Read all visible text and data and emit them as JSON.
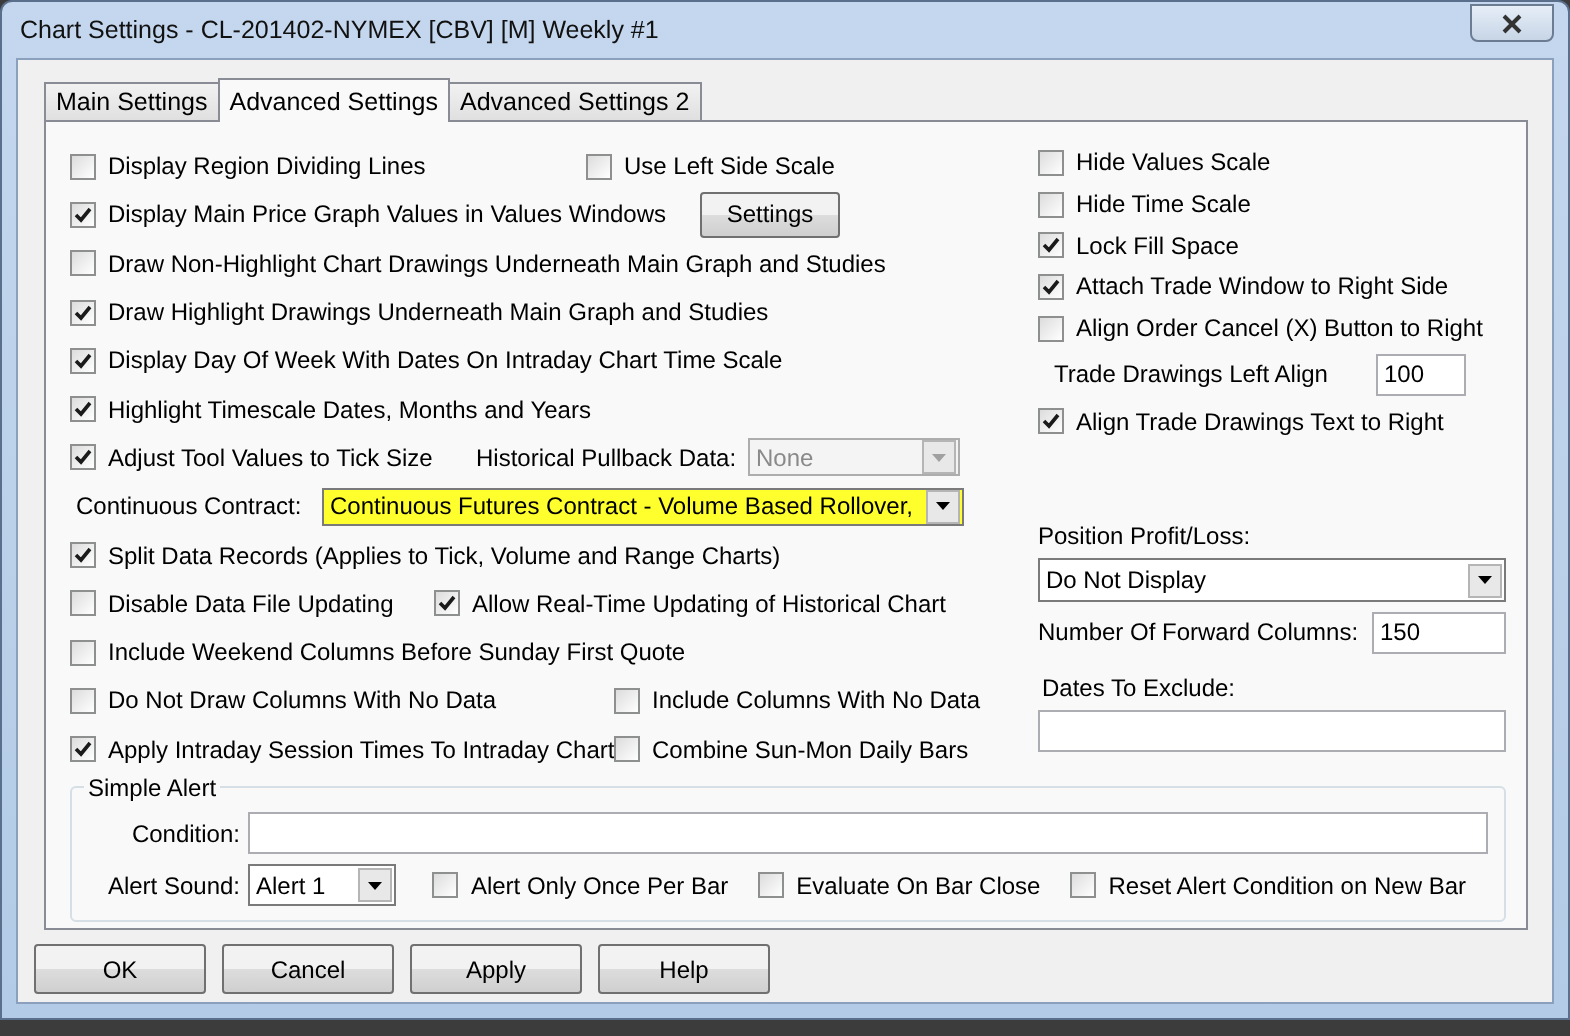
{
  "window": {
    "title": "Chart Settings - CL-201402-NYMEX [CBV] [M]  Weekly  #1"
  },
  "tabs": [
    {
      "label": "Main Settings",
      "selected": false
    },
    {
      "label": "Advanced Settings",
      "selected": true
    },
    {
      "label": "Advanced Settings 2",
      "selected": false
    }
  ],
  "left_rows": [
    {
      "items": [
        {
          "kind": "checkbox",
          "label": "Display Region Dividing Lines",
          "checked": false
        },
        {
          "kind": "checkbox",
          "label": "Use Left Side Scale",
          "checked": false
        }
      ]
    },
    {
      "items": [
        {
          "kind": "checkbox",
          "label": "Display Main Price Graph Values in Values Windows",
          "checked": true
        },
        {
          "kind": "button",
          "label": "Settings"
        }
      ]
    },
    {
      "items": [
        {
          "kind": "checkbox",
          "label": "Draw Non-Highlight Chart Drawings Underneath Main Graph and Studies",
          "checked": false
        }
      ]
    },
    {
      "items": [
        {
          "kind": "checkbox",
          "label": "Draw Highlight Drawings Underneath Main Graph and Studies",
          "checked": true
        }
      ]
    },
    {
      "items": [
        {
          "kind": "checkbox",
          "label": "Display Day Of Week With Dates On Intraday Chart Time Scale",
          "checked": true
        }
      ]
    },
    {
      "items": [
        {
          "kind": "checkbox",
          "label": "Highlight Timescale Dates, Months and Years",
          "checked": true
        }
      ]
    },
    {
      "items": [
        {
          "kind": "checkbox",
          "label": "Adjust Tool Values to Tick Size",
          "checked": true
        },
        {
          "kind": "label",
          "label": "Historical Pullback Data:"
        },
        {
          "kind": "select",
          "value": "None",
          "disabled": true,
          "highlighted": false
        }
      ]
    },
    {
      "items": [
        {
          "kind": "label",
          "label": "Continuous Contract:"
        },
        {
          "kind": "select",
          "value": "Continuous Futures Contract - Volume Based Rollover,",
          "disabled": false,
          "highlighted": true
        }
      ]
    },
    {
      "items": [
        {
          "kind": "checkbox",
          "label": "Split Data Records (Applies to Tick, Volume and Range Charts)",
          "checked": true
        }
      ]
    },
    {
      "items": [
        {
          "kind": "checkbox",
          "label": "Disable Data File Updating",
          "checked": false
        },
        {
          "kind": "checkbox",
          "label": "Allow Real-Time Updating of Historical Chart",
          "checked": true
        }
      ]
    },
    {
      "items": [
        {
          "kind": "checkbox",
          "label": "Include Weekend Columns Before Sunday First Quote",
          "checked": false
        }
      ]
    },
    {
      "items": [
        {
          "kind": "checkbox",
          "label": "Do Not Draw Columns With No Data",
          "checked": false
        },
        {
          "kind": "checkbox",
          "label": "Include Columns With No Data",
          "checked": false
        }
      ]
    },
    {
      "items": [
        {
          "kind": "checkbox",
          "label": "Apply Intraday Session Times To Intraday Chart",
          "checked": true
        },
        {
          "kind": "checkbox",
          "label": "Combine Sun-Mon Daily Bars",
          "checked": false
        }
      ]
    }
  ],
  "right_items": [
    {
      "kind": "checkbox",
      "label": "Hide Values Scale",
      "checked": false
    },
    {
      "kind": "checkbox",
      "label": "Hide Time Scale",
      "checked": false
    },
    {
      "kind": "checkbox",
      "label": "Lock Fill Space",
      "checked": true
    },
    {
      "kind": "checkbox",
      "label": "Attach Trade Window to Right Side",
      "checked": true
    },
    {
      "kind": "checkbox",
      "label": "Align Order Cancel (X) Button to Right",
      "checked": false
    },
    {
      "kind": "number",
      "label": "Trade Drawings Left Align",
      "value": "100"
    },
    {
      "kind": "checkbox",
      "label": "Align Trade Drawings Text to Right",
      "checked": true
    },
    {
      "kind": "dropdown",
      "label": "Position Profit/Loss:",
      "value": "Do Not Display"
    },
    {
      "kind": "number",
      "label": "Number Of Forward Columns:",
      "value": "150"
    },
    {
      "kind": "text",
      "label": "Dates To Exclude:"
    }
  ],
  "simple_alert": {
    "title": "Simple Alert",
    "condition_label": "Condition:",
    "sound_label": "Alert Sound:",
    "sound_value": "Alert 1",
    "options": [
      {
        "label": "Alert Only Once Per Bar",
        "checked": false
      },
      {
        "label": "Evaluate On Bar Close",
        "checked": false
      },
      {
        "label": "Reset Alert Condition on New Bar",
        "checked": false
      }
    ]
  },
  "buttons": [
    "OK",
    "Cancel",
    "Apply",
    "Help"
  ]
}
